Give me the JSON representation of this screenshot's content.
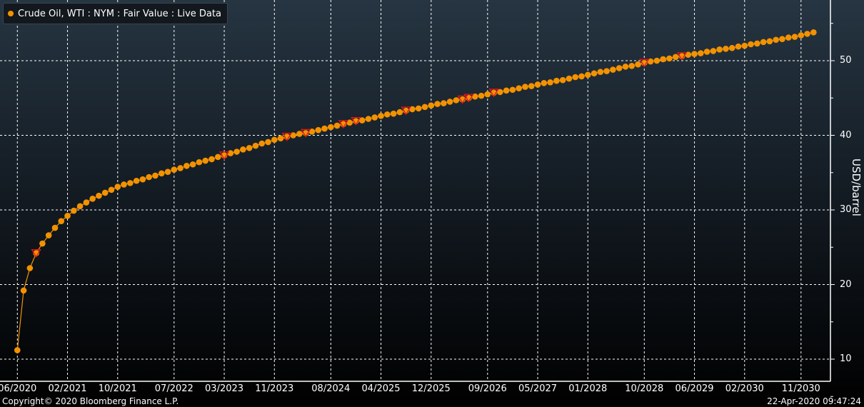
{
  "chart_data": {
    "type": "line",
    "title": "",
    "legend": {
      "label": "Crude Oil, WTI : NYM : Fair Value : Live Data",
      "placement": "top-left"
    },
    "ylabel": "USD/barrel",
    "xlabel": "",
    "ylim": [
      7,
      58
    ],
    "yticks": [
      10,
      20,
      30,
      40,
      50
    ],
    "grid": true,
    "start_month": "06/2020",
    "frequency": "monthly",
    "xtick_labels": [
      "06/2020",
      "02/2021",
      "10/2021",
      "07/2022",
      "03/2023",
      "11/2023",
      "08/2024",
      "04/2025",
      "12/2025",
      "09/2026",
      "05/2027",
      "01/2028",
      "10/2028",
      "06/2029",
      "02/2030",
      "11/2030"
    ],
    "xtick_month_index": [
      0,
      8,
      16,
      25,
      33,
      41,
      50,
      58,
      66,
      75,
      83,
      91,
      100,
      108,
      116,
      125
    ],
    "values": [
      11.2,
      19.2,
      22.2,
      24.2,
      25.5,
      26.6,
      27.6,
      28.5,
      29.2,
      29.9,
      30.5,
      31.0,
      31.5,
      31.9,
      32.3,
      32.7,
      33.1,
      33.4,
      33.6,
      33.9,
      34.1,
      34.4,
      34.6,
      34.9,
      35.1,
      35.4,
      35.6,
      35.9,
      36.1,
      36.4,
      36.6,
      36.8,
      37.1,
      37.3,
      37.6,
      37.8,
      38.1,
      38.3,
      38.6,
      38.9,
      39.1,
      39.4,
      39.6,
      39.8,
      40.0,
      40.2,
      40.3,
      40.5,
      40.7,
      40.9,
      41.1,
      41.3,
      41.5,
      41.7,
      41.9,
      42.0,
      42.2,
      42.4,
      42.6,
      42.8,
      42.9,
      43.1,
      43.3,
      43.5,
      43.6,
      43.8,
      44.0,
      44.2,
      44.3,
      44.5,
      44.7,
      44.8,
      45.0,
      45.2,
      45.3,
      45.5,
      45.7,
      45.8,
      46.0,
      46.1,
      46.3,
      46.5,
      46.6,
      46.8,
      47.0,
      47.1,
      47.3,
      47.4,
      47.6,
      47.8,
      47.9,
      48.1,
      48.3,
      48.5,
      48.6,
      48.8,
      49.0,
      49.2,
      49.3,
      49.5,
      49.7,
      49.9,
      50.0,
      50.2,
      50.3,
      50.5,
      50.6,
      50.8,
      50.9,
      51.0,
      51.2,
      51.3,
      51.5,
      51.6,
      51.7,
      51.9,
      52.0,
      52.2,
      52.3,
      52.5,
      52.6,
      52.8,
      52.9,
      53.1,
      53.2,
      53.4,
      53.6,
      53.8
    ],
    "marker_indices": [
      3,
      33,
      43,
      46,
      52,
      54,
      62,
      71,
      72,
      76,
      100,
      106
    ],
    "series_color": "#f39200",
    "marker_color": "#e8141c"
  },
  "footer": {
    "copyright": "Copyright© 2020 Bloomberg Finance L.P.",
    "timestamp": "22-Apr-2020 09:47:24"
  }
}
